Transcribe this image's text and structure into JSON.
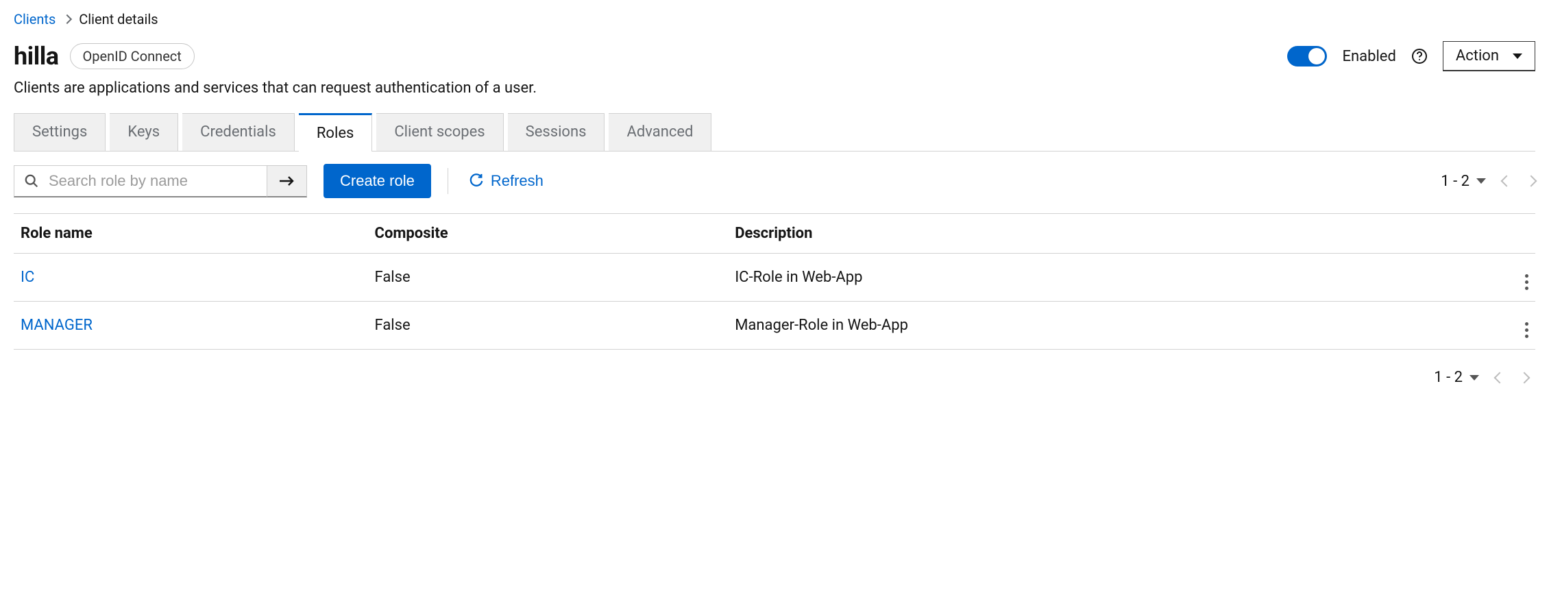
{
  "breadcrumb": {
    "parent": "Clients",
    "current": "Client details"
  },
  "header": {
    "title": "hilla",
    "protocolBadge": "OpenID Connect",
    "enabledLabel": "Enabled",
    "actionLabel": "Action",
    "description": "Clients are applications and services that can request authentication of a user."
  },
  "tabs": [
    {
      "label": "Settings",
      "active": false
    },
    {
      "label": "Keys",
      "active": false
    },
    {
      "label": "Credentials",
      "active": false
    },
    {
      "label": "Roles",
      "active": true
    },
    {
      "label": "Client scopes",
      "active": false
    },
    {
      "label": "Sessions",
      "active": false
    },
    {
      "label": "Advanced",
      "active": false
    }
  ],
  "toolbar": {
    "searchPlaceholder": "Search role by name",
    "createLabel": "Create role",
    "refreshLabel": "Refresh",
    "pageRange": "1 - 2"
  },
  "table": {
    "columns": {
      "name": "Role name",
      "composite": "Composite",
      "description": "Description"
    },
    "rows": [
      {
        "name": "IC",
        "composite": "False",
        "description": "IC-Role in Web-App"
      },
      {
        "name": "MANAGER",
        "composite": "False",
        "description": "Manager-Role in Web-App"
      }
    ]
  },
  "footer": {
    "pageRange": "1 - 2"
  }
}
